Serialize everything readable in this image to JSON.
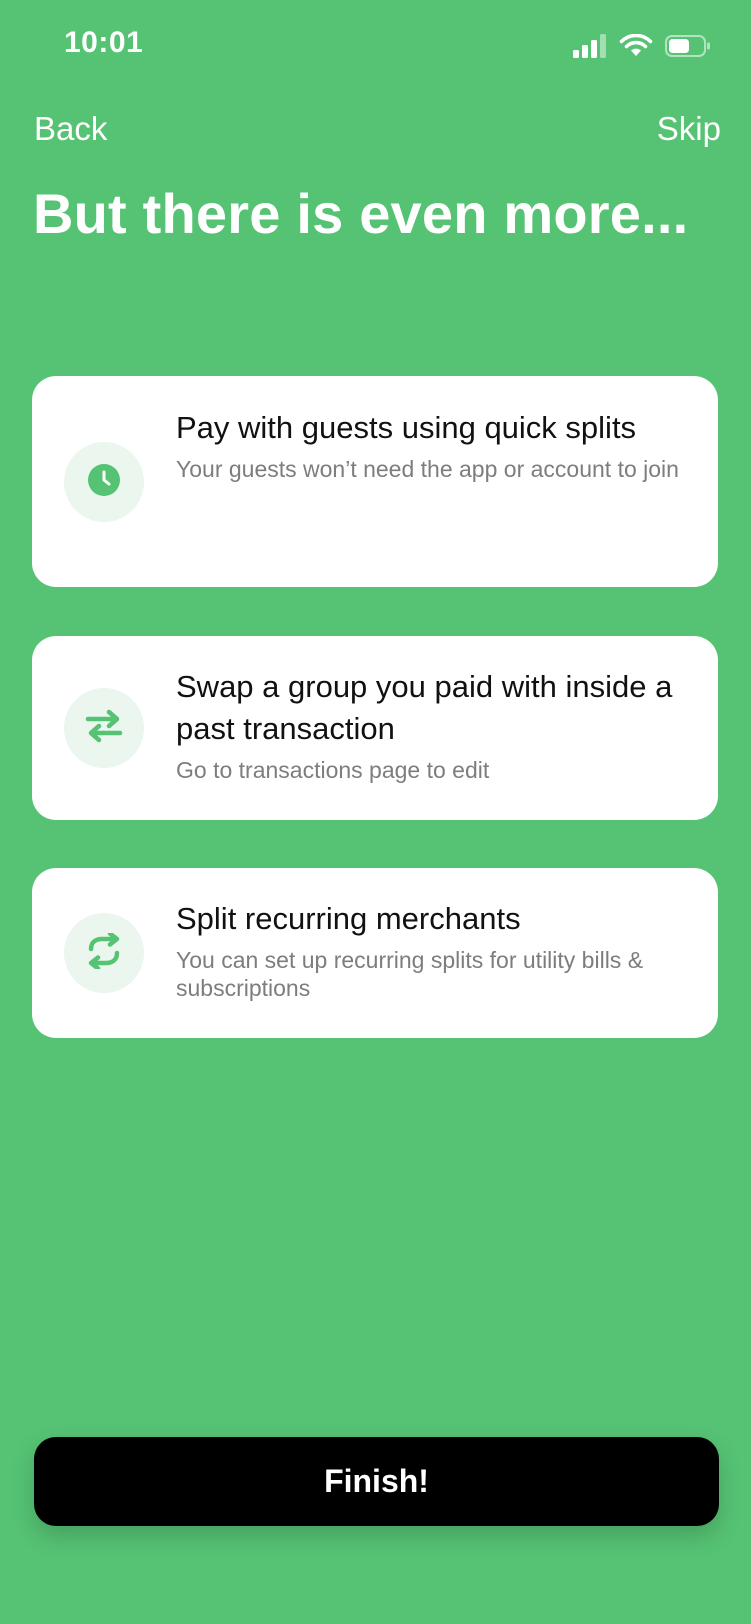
{
  "status_bar": {
    "time": "10:01",
    "icons": [
      "signal-icon",
      "wifi-icon",
      "battery-icon"
    ]
  },
  "nav": {
    "back_label": "Back",
    "skip_label": "Skip"
  },
  "title": "But there is even more...",
  "cards": [
    {
      "icon": "clock-icon",
      "title": "Pay with guests using quick splits",
      "description": "Your guests won’t need the app or account to join"
    },
    {
      "icon": "swap-arrows-icon",
      "title": "Swap a group you paid with inside a past transaction",
      "description": "Go to transactions page to edit"
    },
    {
      "icon": "recurring-icon",
      "title": "Split recurring merchants",
      "description": "You can set up recurring splits for utility bills & subscriptions"
    }
  ],
  "finish_label": "Finish!",
  "colors": {
    "background": "#55c373",
    "accent": "#55c373",
    "icon_circle": "#eaf6ee",
    "button": "#000000"
  }
}
